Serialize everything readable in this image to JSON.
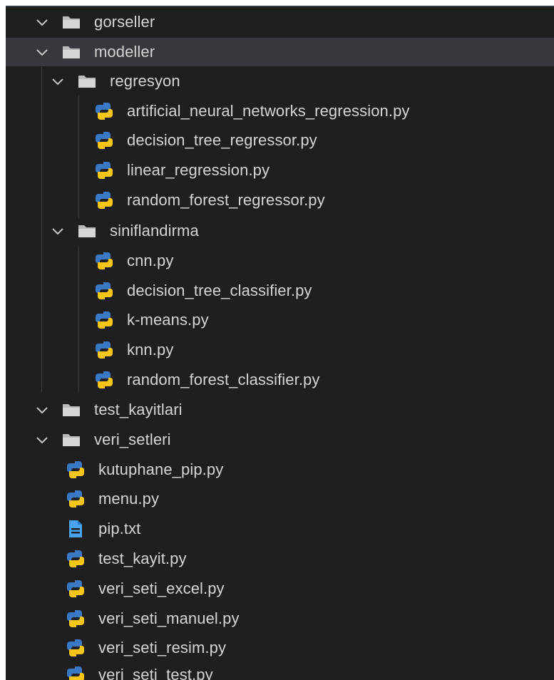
{
  "tree": {
    "gorseller": "gorseller",
    "modeller": "modeller",
    "regresyon": "regresyon",
    "regresyon_files": [
      "artificial_neural_networks_regression.py",
      "decision_tree_regressor.py",
      "linear_regression.py",
      "random_forest_regressor.py"
    ],
    "siniflandirma": "siniflandirma",
    "siniflandirma_files": [
      "cnn.py",
      "decision_tree_classifier.py",
      "k-means.py",
      "knn.py",
      "random_forest_classifier.py"
    ],
    "test_kayitlari": "test_kayitlari",
    "veri_setleri": "veri_setleri",
    "root_files": [
      "kutuphane_pip.py",
      "menu.py",
      "pip.txt",
      "test_kayit.py",
      "veri_seti_excel.py",
      "veri_seti_manuel.py",
      "veri_seti_resim.py",
      "veri_seti_test.py"
    ]
  },
  "icons": {
    "folder": "folder-icon",
    "chevron": "chevron-down-icon",
    "python": "python-icon",
    "text": "text-file-icon"
  },
  "colors": {
    "background": "#1f1f1f",
    "selected": "#37373d",
    "text": "#d4d4d4",
    "python_blue": "#3b78c4",
    "python_yellow": "#f5c518",
    "txt_blue": "#4aa3f0"
  }
}
